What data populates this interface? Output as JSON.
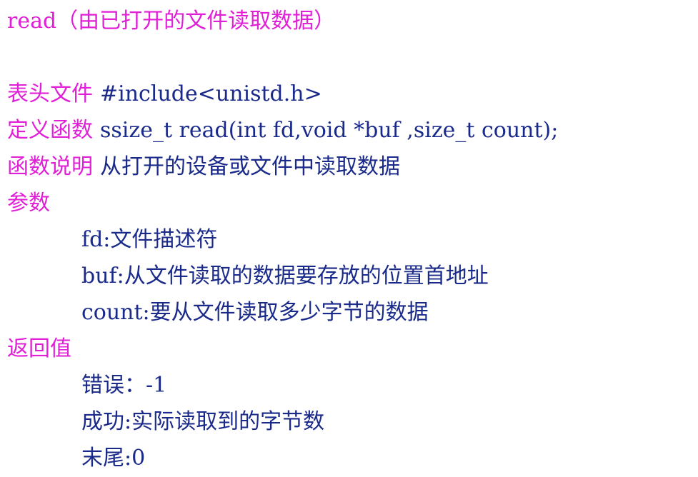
{
  "title": "read（由已打开的文件读取数据）",
  "header_label": "表头文件",
  "header_value": "#include<unistd.h>",
  "definition_label": "定义函数",
  "definition_value": "ssize_t read(int fd,void *buf ,size_t count);",
  "description_label": "函数说明",
  "description_value": "从打开的设备或文件中读取数据",
  "params_label": "参数",
  "params": [
    "fd:文件描述符",
    "buf:从文件读取的数据要存放的位置首地址",
    "count:要从文件读取多少字节的数据"
  ],
  "return_label": "返回值",
  "returns": [
    "错误：-1",
    "成功:实际读取到的字节数",
    "末尾:0"
  ],
  "colors": {
    "label": "#e01fd6",
    "text": "#1a2a8a"
  }
}
